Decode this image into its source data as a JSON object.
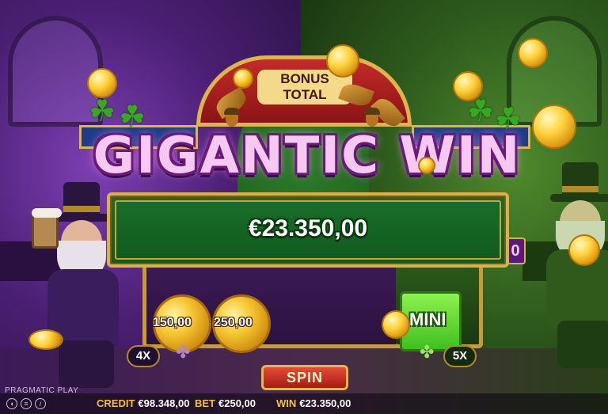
{
  "game": {
    "provider": "PRAGMATIC PLAY",
    "sign_label": "BONUS TOTAL",
    "win_title": "GIGANTIC WIN",
    "win_amount": "€23.350,00"
  },
  "reels": {
    "coin_values": [
      "150,00",
      "250,00"
    ],
    "mini_label": "MINI",
    "multipliers": [
      "4X",
      "5X"
    ],
    "side_panel_fragment": "0"
  },
  "controls": {
    "spin_label": "SPIN",
    "sound_icon": "speaker-icon",
    "menu_icon": "hamburger-icon",
    "info_icon": "info-icon"
  },
  "status": {
    "credit_label": "CREDIT",
    "credit_value": "€98.348,00",
    "bet_label": "BET",
    "bet_value": "€250,00",
    "win_label": "WIN",
    "win_value": "€23.350,00"
  },
  "colors": {
    "left_theme": "#4a1f73",
    "right_theme": "#2d5a1c",
    "title_fill": "#f6c8f2",
    "panel_green": "#1a6e2a",
    "gold": "#d9b04a"
  }
}
